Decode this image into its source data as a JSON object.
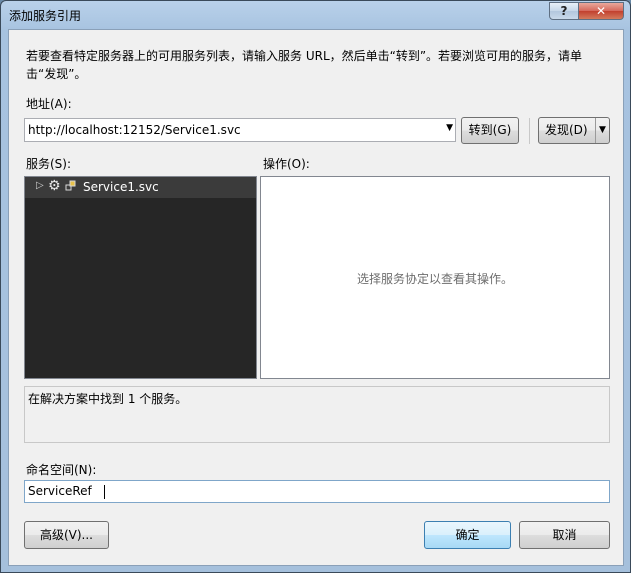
{
  "window": {
    "title": "添加服务引用",
    "help_label": "?",
    "close_label": "✕"
  },
  "instructions": "若要查看特定服务器上的可用服务列表，请输入服务 URL，然后单击“转到”。若要浏览可用的服务，请单击“发现”。",
  "address": {
    "label": "地址(A):",
    "value": "http://localhost:12152/Service1.svc"
  },
  "buttons": {
    "go": "转到(G)",
    "discover": "发现(D)",
    "advanced": "高级(V)...",
    "ok": "确定",
    "cancel": "取消"
  },
  "services": {
    "label": "服务(S):",
    "items": [
      {
        "label": "Service1.svc",
        "expanded": false,
        "selected": true
      }
    ]
  },
  "operations": {
    "label": "操作(O):",
    "hint": "选择服务协定以查看其操作。"
  },
  "status_text": "在解决方案中找到 1 个服务。",
  "namespace": {
    "label": "命名空间(N):",
    "value": "ServiceRef"
  },
  "colors": {
    "tree_background": "#262626",
    "default_button_border": "#3c7fb1",
    "close_button": "#c2402e"
  }
}
